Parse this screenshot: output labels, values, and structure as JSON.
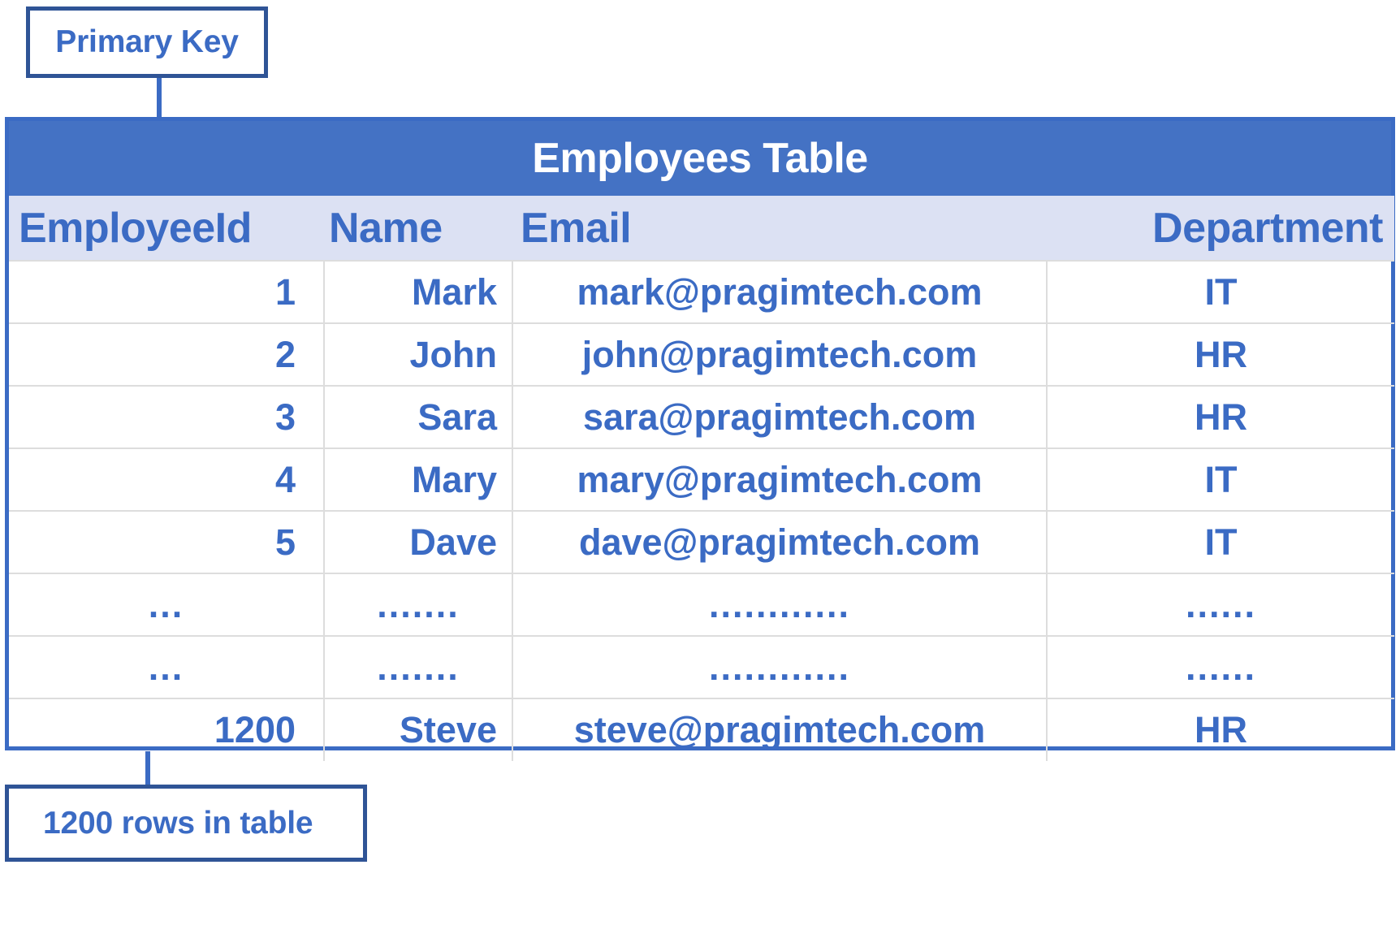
{
  "annotations": {
    "primary_key_label": "Primary Key",
    "row_count_label": "1200 rows in table"
  },
  "table": {
    "title": "Employees Table",
    "columns": [
      "EmployeeId",
      "Name",
      "Email",
      "Department"
    ],
    "rows": [
      {
        "id": "1",
        "name": "Mark",
        "email": "mark@pragimtech.com",
        "department": "IT"
      },
      {
        "id": "2",
        "name": "John",
        "email": "john@pragimtech.com",
        "department": "HR"
      },
      {
        "id": "3",
        "name": "Sara",
        "email": "sara@pragimtech.com",
        "department": "HR"
      },
      {
        "id": "4",
        "name": "Mary",
        "email": "mary@pragimtech.com",
        "department": "IT"
      },
      {
        "id": "5",
        "name": "Dave",
        "email": "dave@pragimtech.com",
        "department": "IT"
      },
      {
        "id": "...",
        "name": ".......",
        "email": "............",
        "department": "......"
      },
      {
        "id": "...",
        "name": ".......",
        "email": "............",
        "department": "......"
      },
      {
        "id": "1200",
        "name": "Steve",
        "email": "steve@pragimtech.com",
        "department": "HR"
      }
    ]
  },
  "colors": {
    "title_bar": "#4472C4",
    "header_row": "#DCE1F3",
    "text_blue": "#3B6BC4",
    "callout_border": "#2F5496",
    "grid_line": "#DDDDDD"
  }
}
